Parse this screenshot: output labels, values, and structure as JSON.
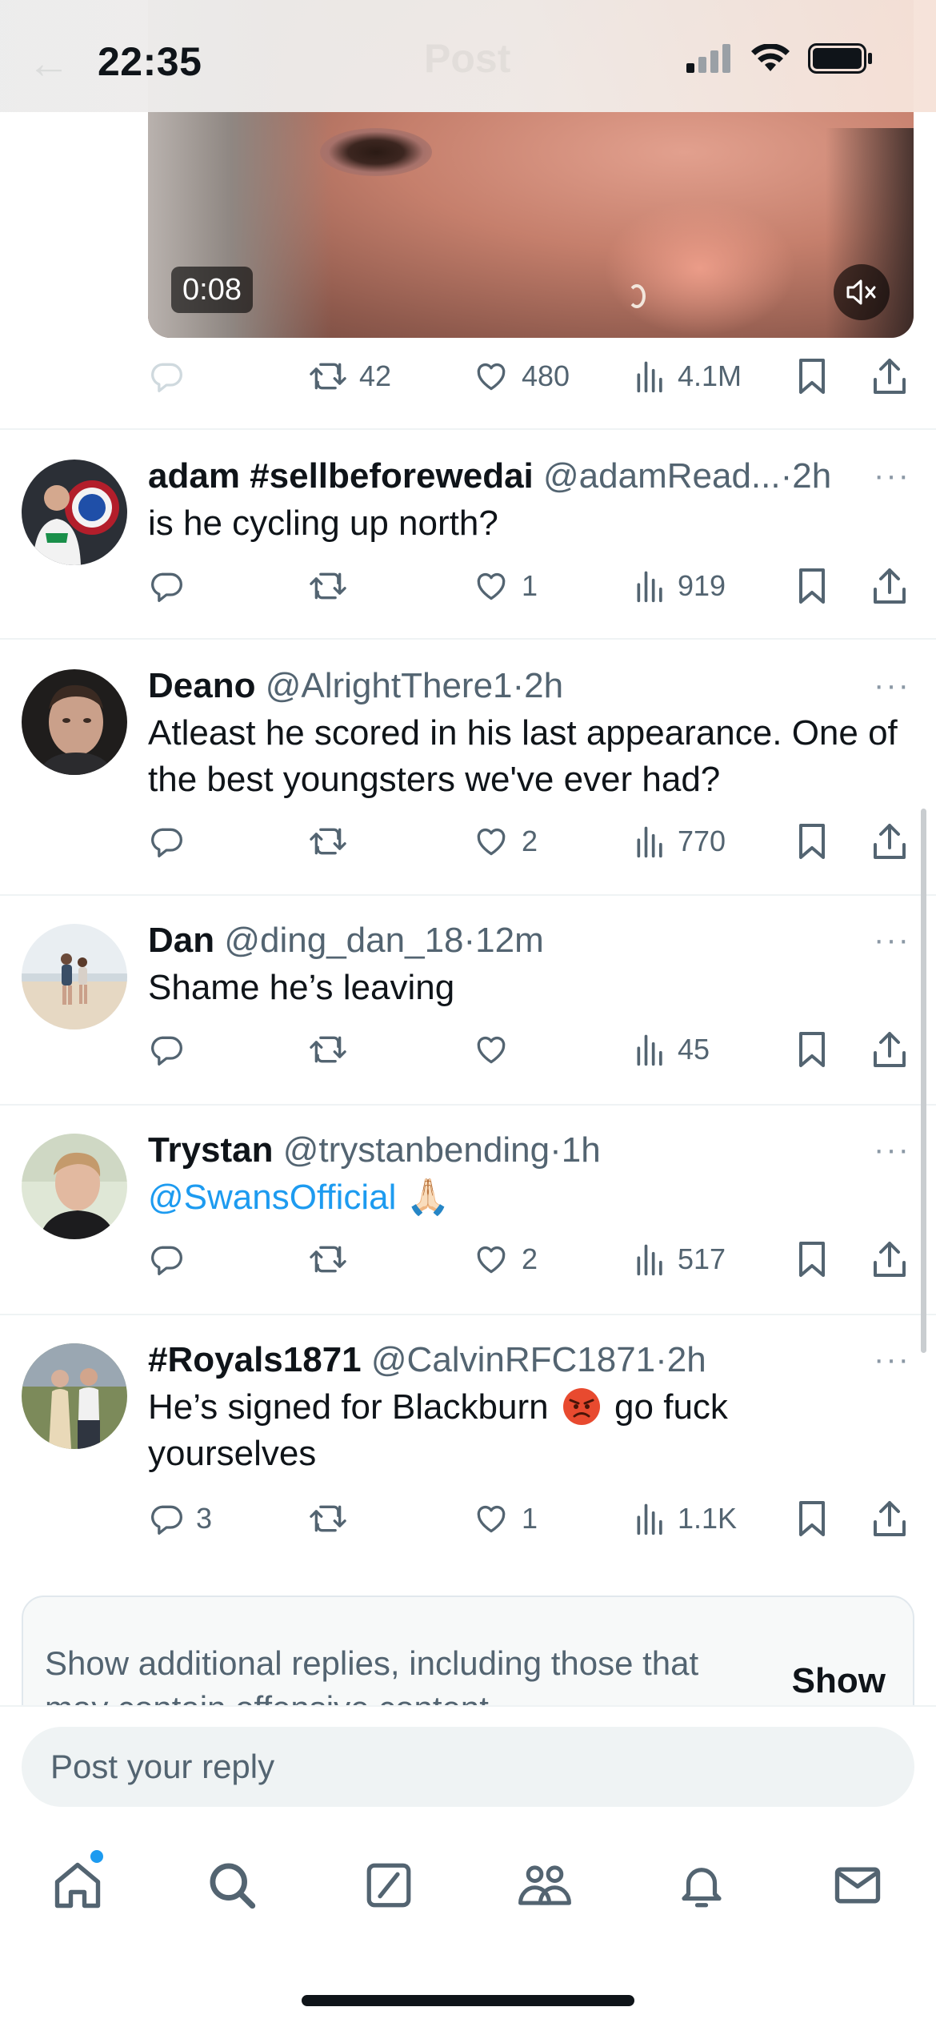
{
  "status_bar": {
    "time": "22:35",
    "ghost_title": "Post"
  },
  "video": {
    "duration": "0:08",
    "muted": true
  },
  "main_post_actions": {
    "retweets": "42",
    "likes": "480",
    "views": "4.1M"
  },
  "replies": [
    {
      "name": "adam #sellbeforewedai",
      "handle": "@adamRead...",
      "dot": "·",
      "time": "2h",
      "lines": [
        "is he cycling up north?"
      ],
      "reply_count": "",
      "retweets": "",
      "likes": "1",
      "views": "919"
    },
    {
      "name": "Deano",
      "handle": "@AlrightThere1",
      "dot": "·",
      "time": "2h",
      "lines": [
        "Atleast he scored in his last appearance. One of",
        "the best youngsters we've ever had?"
      ],
      "reply_count": "",
      "retweets": "",
      "likes": "2",
      "views": "770"
    },
    {
      "name": "Dan",
      "handle": "@ding_dan_18",
      "dot": "·",
      "time": "12m",
      "lines": [
        "Shame he’s leaving"
      ],
      "reply_count": "",
      "retweets": "",
      "likes": "",
      "views": "45"
    },
    {
      "name": "Trystan",
      "handle": "@trystanbending",
      "dot": "·",
      "time": "1h",
      "mention": "@SwansOfficial",
      "emoji": "🙏🏻",
      "reply_count": "",
      "retweets": "",
      "likes": "2",
      "views": "517"
    },
    {
      "name": "#Royals1871",
      "handle": "@CalvinRFC1871",
      "dot": "·",
      "time": "2h",
      "line1_before": "He’s signed for Blackburn",
      "line1_after": "go fuck",
      "line2": "yourselves",
      "reply_count": "3",
      "retweets": "",
      "likes": "1",
      "views": "1.1K"
    }
  ],
  "more_glyph": "···",
  "show_more": {
    "text": "Show additional replies, including those that may contain offensive content",
    "button": "Show"
  },
  "reply_bar": {
    "placeholder": "Post your reply"
  },
  "tabs": [
    "home-icon",
    "search-icon",
    "grok-icon",
    "communities-icon",
    "notifications-icon",
    "messages-icon"
  ],
  "colors": {
    "accent": "#1d9bf0",
    "secondary_text": "#536471",
    "text": "#0f1419"
  }
}
